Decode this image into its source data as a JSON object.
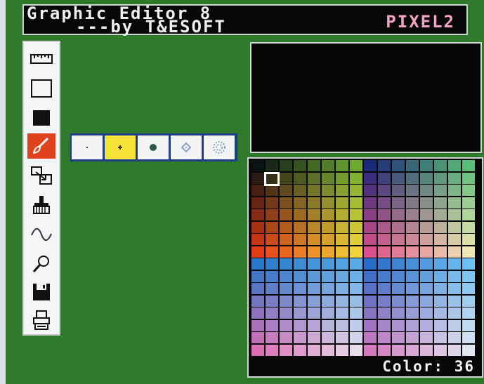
{
  "header": {
    "title": "Graphic Editor 8",
    "author": "---by T&ESOFT",
    "mode": "PIXEL2"
  },
  "tools": [
    {
      "name": "ruler-tool",
      "icon": "ruler-icon"
    },
    {
      "name": "frame-tool",
      "icon": "empty-rectangle-icon"
    },
    {
      "name": "fill-box-tool",
      "icon": "filled-rectangle-icon"
    },
    {
      "name": "brush-tool",
      "icon": "brush-icon",
      "active": true
    },
    {
      "name": "copy-tool",
      "icon": "copy-arrow-icon"
    },
    {
      "name": "paint-tool",
      "icon": "paint-brush-icon"
    },
    {
      "name": "curve-tool",
      "icon": "wave-icon"
    },
    {
      "name": "zoom-tool",
      "icon": "magnifier-icon"
    },
    {
      "name": "disk-tool",
      "icon": "floppy-disk-icon"
    },
    {
      "name": "print-tool",
      "icon": "printer-icon"
    }
  ],
  "brushes": [
    {
      "size": "tiny",
      "selected": false
    },
    {
      "size": "small",
      "selected": true
    },
    {
      "size": "round",
      "selected": false
    },
    {
      "size": "diamond",
      "selected": false
    },
    {
      "size": "large",
      "selected": false
    }
  ],
  "palette": {
    "rows": 16,
    "cols": 16,
    "selected_index": 17
  },
  "status": {
    "color_label": "Color: 36"
  },
  "colors": {
    "background": "#2f7a2c",
    "tool_active": "#e0421e",
    "brush_selected": "#f6e43a",
    "title_text": "#ecf0f2",
    "mode_text": "#f4a3c6"
  }
}
